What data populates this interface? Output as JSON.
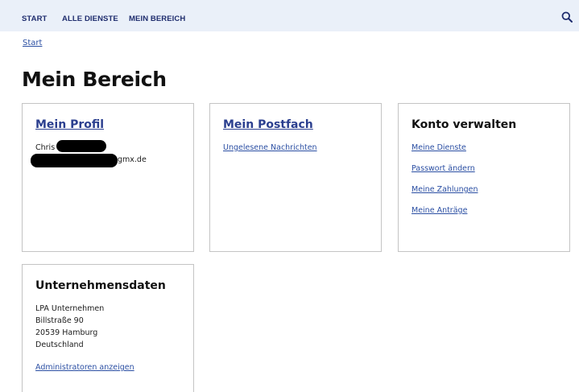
{
  "nav": {
    "items": [
      "START",
      "ALLE DIENSTE",
      "MEIN BEREICH"
    ],
    "search_icon": "search-icon"
  },
  "breadcrumb": {
    "start": "Start"
  },
  "page": {
    "title": "Mein Bereich"
  },
  "profile": {
    "title": "Mein Profil",
    "name_visible": "Chris",
    "email_visible": "gmx.de"
  },
  "mailbox": {
    "title": "Mein Postfach",
    "links": [
      "Ungelesene Nachrichten"
    ]
  },
  "account": {
    "title": "Konto verwalten",
    "links": [
      "Meine Dienste",
      "Passwort ändern",
      "Meine Zahlungen",
      "Meine Anträge"
    ]
  },
  "company": {
    "title": "Unternehmensdaten",
    "address": [
      "LPA Unternehmen",
      "Billstraße 90",
      "20539 Hamburg",
      "Deutschland"
    ],
    "admin_link": "Administratoren anzeigen"
  },
  "colors": {
    "nav_bg": "#eaf0f9",
    "nav_text": "#1f2d6e",
    "link": "#2b4fa3",
    "border": "#c4c4c4"
  }
}
